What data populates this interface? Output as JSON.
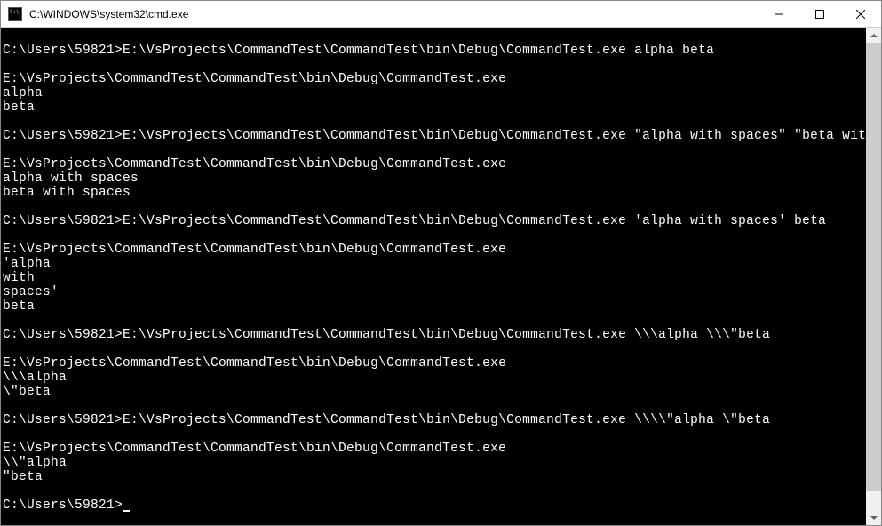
{
  "window": {
    "title": "C:\\WINDOWS\\system32\\cmd.exe"
  },
  "terminal": {
    "lines": [
      "",
      "C:\\Users\\59821>E:\\VsProjects\\CommandTest\\CommandTest\\bin\\Debug\\CommandTest.exe alpha beta",
      "",
      "E:\\VsProjects\\CommandTest\\CommandTest\\bin\\Debug\\CommandTest.exe",
      "alpha",
      "beta",
      "",
      "C:\\Users\\59821>E:\\VsProjects\\CommandTest\\CommandTest\\bin\\Debug\\CommandTest.exe \"alpha with spaces\" \"beta with spaces\"",
      "",
      "E:\\VsProjects\\CommandTest\\CommandTest\\bin\\Debug\\CommandTest.exe",
      "alpha with spaces",
      "beta with spaces",
      "",
      "C:\\Users\\59821>E:\\VsProjects\\CommandTest\\CommandTest\\bin\\Debug\\CommandTest.exe 'alpha with spaces' beta",
      "",
      "E:\\VsProjects\\CommandTest\\CommandTest\\bin\\Debug\\CommandTest.exe",
      "'alpha",
      "with",
      "spaces'",
      "beta",
      "",
      "C:\\Users\\59821>E:\\VsProjects\\CommandTest\\CommandTest\\bin\\Debug\\CommandTest.exe \\\\\\alpha \\\\\\\"beta",
      "",
      "E:\\VsProjects\\CommandTest\\CommandTest\\bin\\Debug\\CommandTest.exe",
      "\\\\\\alpha",
      "\\\"beta",
      "",
      "C:\\Users\\59821>E:\\VsProjects\\CommandTest\\CommandTest\\bin\\Debug\\CommandTest.exe \\\\\\\\\"alpha \\\"beta",
      "",
      "E:\\VsProjects\\CommandTest\\CommandTest\\bin\\Debug\\CommandTest.exe",
      "\\\\\"alpha",
      "\"beta",
      ""
    ],
    "prompt": "C:\\Users\\59821>"
  }
}
